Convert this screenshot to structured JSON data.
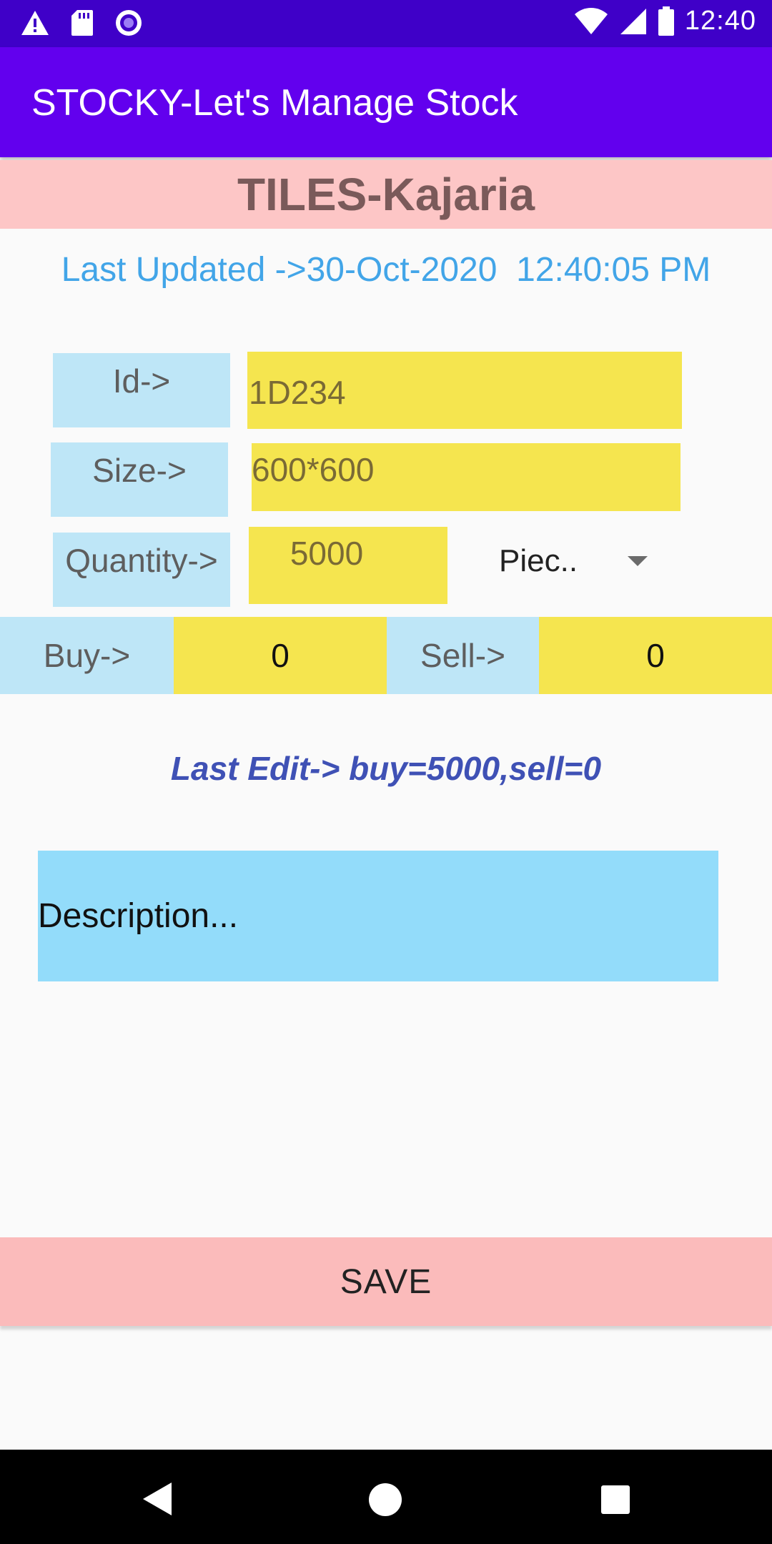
{
  "status_bar": {
    "time": "12:40",
    "icons_left": [
      "warning-icon",
      "sd-card-icon",
      "record-icon"
    ],
    "icons_right": [
      "wifi-icon",
      "signal-icon",
      "battery-icon"
    ]
  },
  "app_bar": {
    "title": "STOCKY-Let's Manage Stock"
  },
  "category_header": {
    "title": "TILES-Kajaria"
  },
  "last_updated": "Last Updated ->30-Oct-2020  12:40:05 PM",
  "form": {
    "id_label": "Id->",
    "id_value": "1D234",
    "size_label": "Size->",
    "size_value": "600*600",
    "quantity_label": "Quantity->",
    "quantity_value": "5000",
    "unit_selected": "Piec..",
    "buy_label": "Buy->",
    "buy_value": "0",
    "sell_label": "Sell->",
    "sell_value": "0"
  },
  "last_edit": "Last Edit-> buy=5000,sell=0",
  "description_placeholder": "Description...",
  "save_label": "SAVE",
  "colors": {
    "status_bar": "#3f00c8",
    "app_bar": "#6200ee",
    "header_pink": "#fdc6c6",
    "label_blue": "#bee6f7",
    "value_yellow": "#f5e54f",
    "description_blue": "#93dcfa",
    "save_pink": "#fbbbbb",
    "last_updated_text": "#42a5e8",
    "last_edit_text": "#3f51b5"
  },
  "nav_bar": {
    "icons": [
      "back-icon",
      "home-icon",
      "recents-icon"
    ]
  }
}
